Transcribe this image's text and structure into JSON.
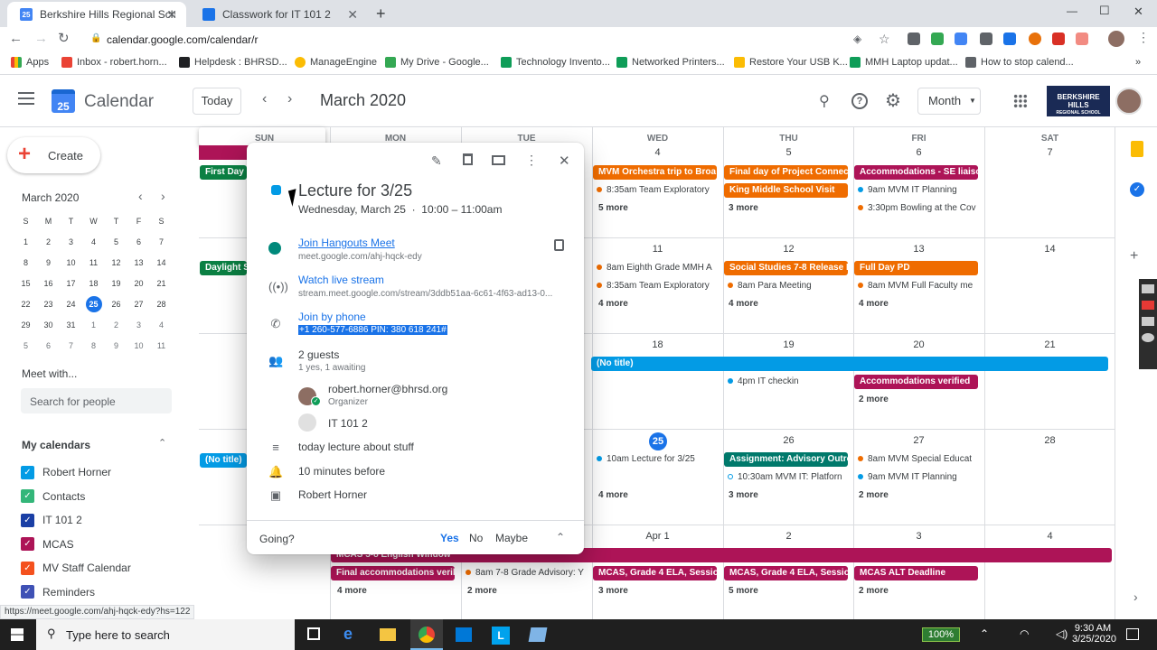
{
  "browser": {
    "tabs": [
      {
        "title": "Berkshire Hills Regional School D",
        "favicon": "25"
      },
      {
        "title": "Classwork for IT 101 2",
        "favicon": ""
      }
    ],
    "url": "calendar.google.com/calendar/r",
    "bookmarks": [
      "Apps",
      "Inbox - robert.horn...",
      "Helpdesk : BHRSD...",
      "ManageEngine",
      "My Drive - Google...",
      "Technology Invento...",
      "Networked Printers...",
      "Restore Your USB K...",
      "MMH Laptop updat...",
      "How to stop calend..."
    ]
  },
  "header": {
    "app_name": "Calendar",
    "logo_day": "25",
    "today_button": "Today",
    "month_title": "March 2020",
    "view_select": "Month",
    "org_name": "BERKSHIRE HILLS",
    "org_sub": "REGIONAL SCHOOL DISTRICT"
  },
  "sidebar": {
    "create": "Create",
    "mini_title": "March 2020",
    "dow": [
      "S",
      "M",
      "T",
      "W",
      "T",
      "F",
      "S"
    ],
    "weeks": [
      [
        "1",
        "2",
        "3",
        "4",
        "5",
        "6",
        "7"
      ],
      [
        "8",
        "9",
        "10",
        "11",
        "12",
        "13",
        "14"
      ],
      [
        "15",
        "16",
        "17",
        "18",
        "19",
        "20",
        "21"
      ],
      [
        "22",
        "23",
        "24",
        "25",
        "26",
        "27",
        "28"
      ],
      [
        "29",
        "30",
        "31",
        "1",
        "2",
        "3",
        "4"
      ],
      [
        "5",
        "6",
        "7",
        "8",
        "9",
        "10",
        "11"
      ]
    ],
    "meet_title": "Meet with...",
    "search_placeholder": "Search for people",
    "my_calendars": "My calendars",
    "calendars": [
      {
        "name": "Robert Horner",
        "color": "#039be5"
      },
      {
        "name": "Contacts",
        "color": "#33b679"
      },
      {
        "name": "IT 101 2",
        "color": "#1a3fa5"
      },
      {
        "name": "MCAS",
        "color": "#ad1457"
      },
      {
        "name": "MV Staff Calendar",
        "color": "#f4511e"
      },
      {
        "name": "Reminders",
        "color": "#3f51b5"
      }
    ]
  },
  "grid": {
    "dow": [
      "SUN",
      "MON",
      "TUE",
      "WED",
      "THU",
      "FRI",
      "SAT"
    ],
    "weeks": [
      {
        "nums": [
          "",
          "",
          "",
          "4",
          "5",
          "6",
          "7"
        ]
      },
      {
        "nums": [
          "",
          "",
          "",
          "11",
          "12",
          "13",
          "14"
        ]
      },
      {
        "nums": [
          "",
          "",
          "",
          "18",
          "19",
          "20",
          "21"
        ]
      },
      {
        "nums": [
          "",
          "",
          "",
          "25",
          "26",
          "27",
          "28"
        ]
      },
      {
        "nums": [
          "",
          "",
          "",
          "Apr 1",
          "2",
          "3",
          "4"
        ]
      }
    ],
    "chips": {
      "w0_sun": "First Day o",
      "w0_wed": "MVM Orchestra trip to Broa",
      "w0_thu": "Final day of Project Connec",
      "w0_thu2": "King Middle School Visit",
      "w0_fri": "Accommodations - SE liaisc",
      "w1_sun": "Daylight S",
      "w1_thu": "Social Studies 7-8 Release I",
      "w1_fri": "Full Day PD",
      "w2_wide": "(No title)",
      "w2_fri": "Accommodations verified",
      "w3_sun": "(No title)",
      "w3_thu": "Assignment: Advisory Outre",
      "w4_wide": "MCAS 5-8 English Window",
      "w4_mon": "Final accommodations veril",
      "w4_wed": "MCAS, Grade 4 ELA, Sessio",
      "w4_thu": "MCAS, Grade 4 ELA, Sessio",
      "w4_fri": "MCAS ALT Deadline"
    },
    "events": {
      "w0_wed": "8:35am Team Exploratory",
      "w0_fri1": "9am MVM IT Planning",
      "w0_fri2": "3:30pm Bowling at the Cov",
      "w1_wed1": "8am Eighth Grade MMH A",
      "w1_wed2": "8:35am Team Exploratory",
      "w1_thu": "8am Para Meeting",
      "w1_fri": "8am MVM Full Faculty me",
      "w2_thu": "4pm IT checkin",
      "w3_wed": "10am Lecture for 3/25",
      "w3_thu": "10:30am MVM IT: Platforn",
      "w3_fri1": "8am MVM Special Educat",
      "w3_fri2": "9am MVM IT Planning",
      "w4_tue": "8am 7-8 Grade Advisory: Y"
    },
    "more": {
      "w0_wed": "5 more",
      "w0_thu": "3 more",
      "w1_wed": "4 more",
      "w1_thu": "4 more",
      "w1_fri": "4 more",
      "w2_fri": "2 more",
      "w3_wed": "4 more",
      "w3_thu": "3 more",
      "w3_fri": "2 more",
      "w4_mon": "4 more",
      "w4_tue": "2 more",
      "w4_wed": "3 more",
      "w4_thu": "5 more",
      "w4_fri": "2 more"
    }
  },
  "popup": {
    "title": "Lecture for 3/25",
    "date": "Wednesday, March 25",
    "time": "10:00 – 11:00am",
    "hangouts": "Join Hangouts Meet",
    "hangouts_url": "meet.google.com/ahj-hqck-edy",
    "stream": "Watch live stream",
    "stream_url": "stream.meet.google.com/stream/3ddb51aa-6c61-4f63-ad13-0...",
    "phone": "Join by phone",
    "phone_num": "+1 260-577-6886 PIN: 380 618 241#",
    "guests": "2 guests",
    "guests_sub": "1 yes, 1 awaiting",
    "guest1": "robert.horner@bhrsd.org",
    "guest1_role": "Organizer",
    "guest2": "IT 101 2",
    "description": "today lecture about stuff",
    "reminder": "10 minutes before",
    "owner": "Robert Horner",
    "going": "Going?",
    "yes": "Yes",
    "no": "No",
    "maybe": "Maybe"
  },
  "status_url": "https://meet.google.com/ahj-hqck-edy?hs=122",
  "taskbar": {
    "search": "Type here to search",
    "battery": "100%",
    "time": "9:30 AM",
    "date": "3/25/2020"
  }
}
